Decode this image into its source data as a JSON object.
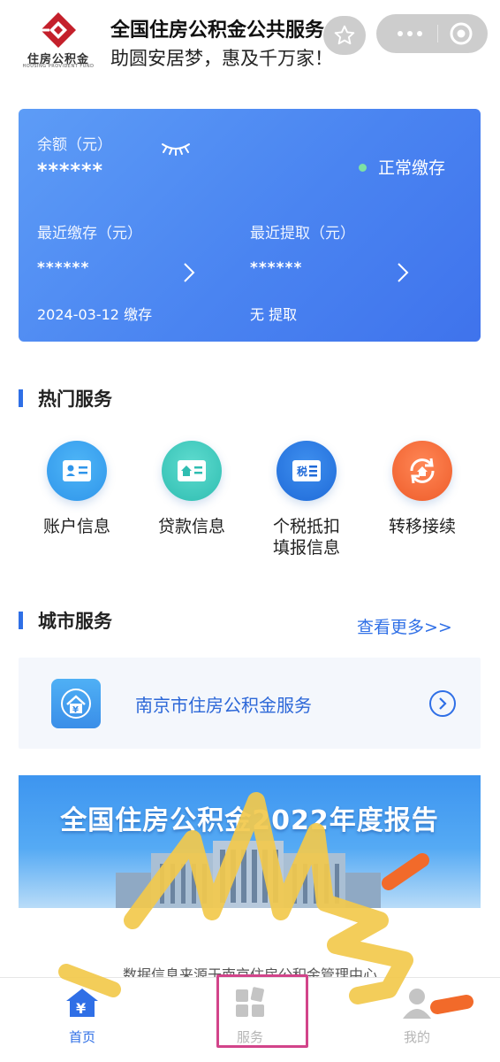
{
  "header": {
    "logo_cn": "住房公积金",
    "logo_en": "HOUSING PROVIDENT FUND",
    "title": "全国住房公积金公共服务",
    "slogan": "助圆安居梦，惠及千万家！"
  },
  "balance_card": {
    "balance_label": "余额（元）",
    "balance_value": "******",
    "status": "正常缴存",
    "recent_deposit_label": "最近缴存（元）",
    "recent_deposit_value": "******",
    "recent_deposit_note": "2024-03-12 缴存",
    "recent_withdraw_label": "最近提取（元）",
    "recent_withdraw_value": "******",
    "recent_withdraw_note": "无 提取"
  },
  "hot_services": {
    "title": "热门服务",
    "items": [
      {
        "label": "账户信息",
        "icon": "account-card-icon",
        "color": "#3aa4ef"
      },
      {
        "label": "贷款信息",
        "icon": "loan-house-card-icon",
        "color": "#3ecbc2"
      },
      {
        "label": "个税抵扣",
        "label2": "填报信息",
        "icon": "tax-icon",
        "color": "#2f7fe8"
      },
      {
        "label": "转移接续",
        "icon": "transfer-house-icon",
        "color": "#f5703f"
      }
    ]
  },
  "city_services": {
    "title": "城市服务",
    "see_more": "查看更多>>",
    "item_label": "南京市住房公积金服务"
  },
  "banner": {
    "title": "全国住房公积金2022年度报告"
  },
  "footer_source": "数据信息来源于南京住房公积金管理中心",
  "tabbar": {
    "home": "首页",
    "services": "服务",
    "mine": "我的"
  },
  "colors": {
    "primary": "#2f6fe6",
    "card_gradient_start": "#5d9cf6",
    "card_gradient_end": "#3f73ec",
    "highlight_box": "#d2448a",
    "scribble_yellow": "#f2c94c",
    "scribble_orange": "#f26a2a"
  }
}
